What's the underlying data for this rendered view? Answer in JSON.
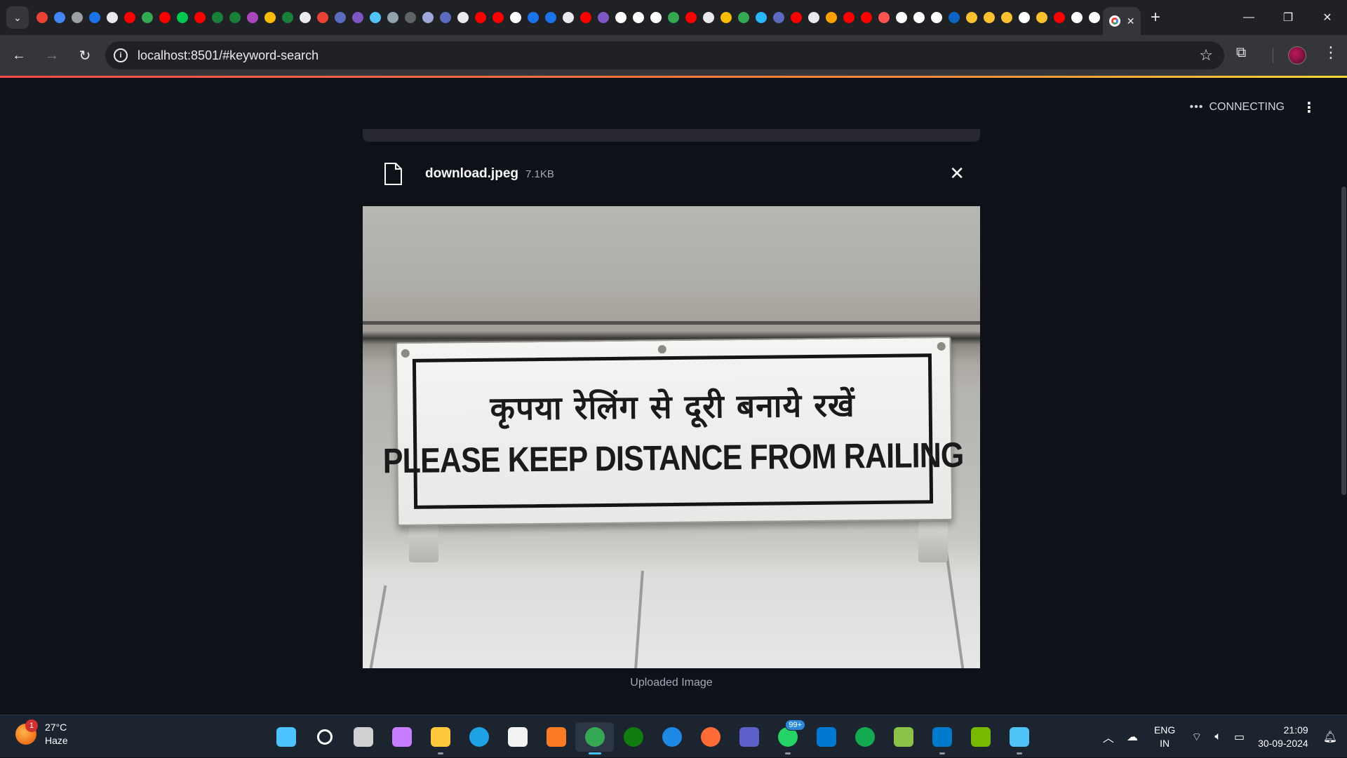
{
  "browser": {
    "url": "localhost:8501/#keyword-search",
    "active_tab_icon": "google-chrome-favicon",
    "favicons": [
      "#ea4335",
      "#4285f4",
      "#9aa0a6",
      "#1a73e8",
      "#e8eaed",
      "#ff0000",
      "#34a853",
      "#ff0000",
      "#00c853",
      "#ff0000",
      "#188038",
      "#188038",
      "#ab47bc",
      "#fbbc04",
      "#188038",
      "#e8eaed",
      "#ea4335",
      "#5c6bc0",
      "#7e57c2",
      "#4fc3f7",
      "#90a4ae",
      "#5f6368",
      "#9fa8da",
      "#5c6bc0",
      "#e8eaed",
      "#ff0000",
      "#ff0000",
      "#ffffff",
      "#1a73e8",
      "#1a73e8",
      "#e8eaed",
      "#ff0000",
      "#7e57c2",
      "#ffffff",
      "#ffffff",
      "#ffffff",
      "#34a853",
      "#ff0000",
      "#e8eaed",
      "#fbbc04",
      "#34a853",
      "#29b6f6",
      "#5c6bc0",
      "#ff0000",
      "#e8eaed",
      "#ffa000",
      "#ff0000",
      "#ff0000",
      "#ff5252",
      "#ffffff",
      "#ffffff",
      "#ffffff",
      "#0a66c2",
      "#fbc02d",
      "#fbc02d",
      "#fbc02d",
      "#ffffff",
      "#fbc02d",
      "#ff0000",
      "#ffffff",
      "#ffffff"
    ]
  },
  "app": {
    "status_text": "CONNECTING",
    "file": {
      "name": "download.jpeg",
      "size": "7.1KB"
    },
    "image": {
      "sign_hindi": "कृपया रेलिंग से दूरी बनाये रखें",
      "sign_english": "PLEASE KEEP DISTANCE FROM RAILING"
    },
    "caption": "Uploaded Image"
  },
  "taskbar": {
    "weather": {
      "temp": "27°C",
      "condition": "Haze",
      "badge": "1"
    },
    "apps": [
      {
        "name": "windows-start-icon",
        "color": "#4cc2ff"
      },
      {
        "name": "search-icon",
        "color": "#ffffff"
      },
      {
        "name": "task-view-icon",
        "color": "#d0d0d0"
      },
      {
        "name": "copilot-icon",
        "color": "#c77dff"
      },
      {
        "name": "file-explorer-icon",
        "color": "#ffc83d"
      },
      {
        "name": "edge-icon",
        "color": "#1fa2e6"
      },
      {
        "name": "microsoft-store-icon",
        "color": "#f3f3f3"
      },
      {
        "name": "xampp-icon",
        "color": "#fb7a24"
      },
      {
        "name": "chrome-icon",
        "color": "#34a853"
      },
      {
        "name": "xbox-icon",
        "color": "#107c10"
      },
      {
        "name": "safari-icon",
        "color": "#1e88e5"
      },
      {
        "name": "postman-icon",
        "color": "#ff6c37"
      },
      {
        "name": "teams-icon",
        "color": "#5b5fc7"
      },
      {
        "name": "whatsapp-icon",
        "color": "#25d366"
      },
      {
        "name": "phone-link-icon",
        "color": "#0078d4"
      },
      {
        "name": "mongodb-compass-icon",
        "color": "#13aa52"
      },
      {
        "name": "paint-icon",
        "color": "#8bc34a"
      },
      {
        "name": "vscode-icon",
        "color": "#007acc"
      },
      {
        "name": "nvidia-icon",
        "color": "#76b900"
      },
      {
        "name": "notepad-icon",
        "color": "#4fc3f7"
      }
    ],
    "whatsapp_badge": "99+",
    "language": {
      "line1": "ENG",
      "line2": "IN"
    },
    "clock": {
      "time": "21:09",
      "date": "30-09-2024"
    }
  }
}
